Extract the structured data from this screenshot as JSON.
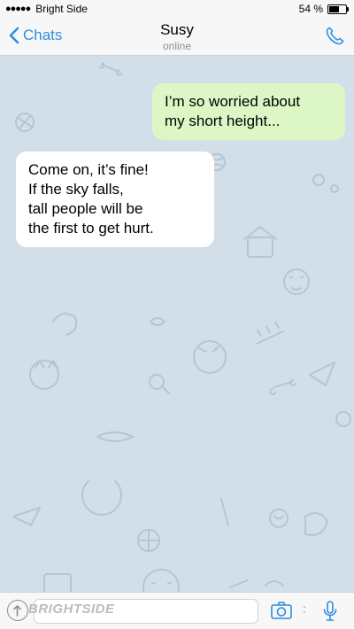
{
  "status_bar": {
    "signal": "●●●●●",
    "carrier": "Bright Side",
    "battery": "54 %",
    "battery_level": 0.54
  },
  "nav": {
    "back_label": "Chats",
    "title": "Susy",
    "subtitle": "online",
    "call_icon": "phone-icon"
  },
  "messages": [
    {
      "direction": "outgoing",
      "lines": [
        "I’m so worried about",
        "my short height..."
      ]
    },
    {
      "direction": "incoming",
      "lines": [
        "Come on, it’s fine!",
        "If the sky falls,",
        "tall people will be",
        "the first to get hurt."
      ]
    }
  ],
  "input": {
    "watermark": "BRIGHTSIDE",
    "separator": ":",
    "icons": [
      "attach-icon",
      "camera-icon",
      "microphone-icon"
    ]
  },
  "colors": {
    "accent": "#2f8cde",
    "chat_background": "#d2dfe9",
    "outgoing_bubble": "#dcf7c5",
    "incoming_bubble": "#ffffff"
  }
}
